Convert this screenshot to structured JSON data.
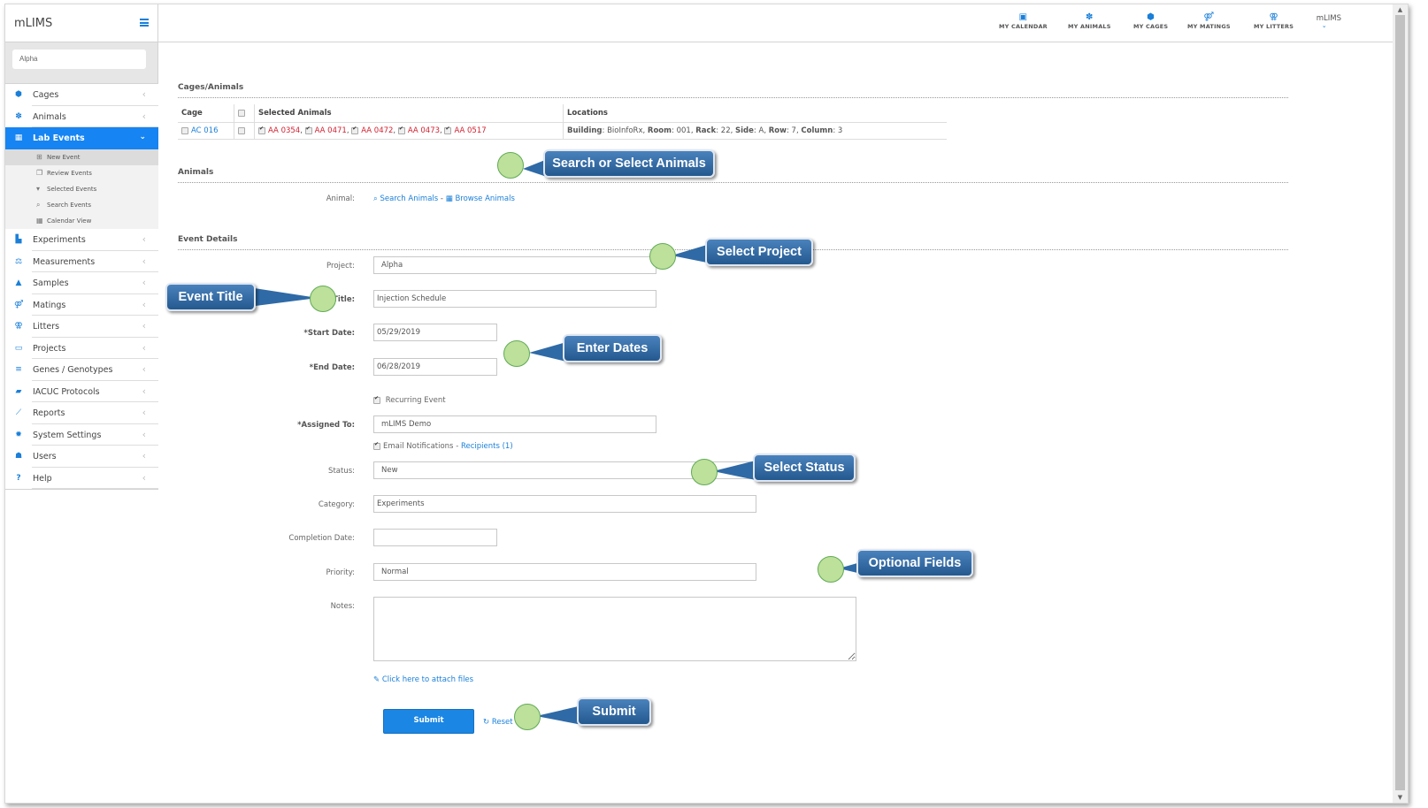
{
  "app": {
    "title": "mLIMS",
    "search_value": "Alpha"
  },
  "sidebar": {
    "items": [
      {
        "label": "Cages",
        "icon": "cube-icon"
      },
      {
        "label": "Animals",
        "icon": "paw-icon"
      },
      {
        "label": "Lab Events",
        "icon": "calendar-icon",
        "active": true
      },
      {
        "label": "Experiments",
        "icon": "flask-doc-icon"
      },
      {
        "label": "Measurements",
        "icon": "balance-scale-icon"
      },
      {
        "label": "Samples",
        "icon": "flask-icon"
      },
      {
        "label": "Matings",
        "icon": "mars-venus-icon"
      },
      {
        "label": "Litters",
        "icon": "venus-double-icon"
      },
      {
        "label": "Projects",
        "icon": "folder-open-icon"
      },
      {
        "label": "Genes / Genotypes",
        "icon": "bars-icon"
      },
      {
        "label": "IACUC Protocols",
        "icon": "book-icon"
      },
      {
        "label": "Reports",
        "icon": "line-chart-icon"
      },
      {
        "label": "System Settings",
        "icon": "gear-icon"
      },
      {
        "label": "Users",
        "icon": "users-icon"
      },
      {
        "label": "Help",
        "icon": "question-icon"
      }
    ],
    "lab_events_sub": [
      {
        "label": "New Event",
        "icon": "calendar-plus-icon",
        "active": true
      },
      {
        "label": "Review Events",
        "icon": "clone-icon"
      },
      {
        "label": "Selected Events",
        "icon": "cart-icon"
      },
      {
        "label": "Search Events",
        "icon": "search-icon"
      },
      {
        "label": "Calendar View",
        "icon": "calendar-grid-icon"
      }
    ]
  },
  "topbar": {
    "items": [
      {
        "label": "MY CALENDAR",
        "icon": "calendar-icon"
      },
      {
        "label": "MY ANIMALS",
        "icon": "paw-icon"
      },
      {
        "label": "MY CAGES",
        "icon": "cube-icon"
      },
      {
        "label": "MY MATINGS",
        "icon": "mars-venus-icon"
      },
      {
        "label": "MY LITTERS",
        "icon": "venus-double-icon"
      }
    ],
    "user": "mLIMS"
  },
  "cages_section": {
    "title": "Cages/Animals",
    "columns": [
      "Cage",
      "",
      "Selected Animals",
      "Locations"
    ],
    "row": {
      "cage": "AC 016",
      "animals": [
        "AA 0354",
        "AA 0471",
        "AA 0472",
        "AA 0473",
        "AA 0517"
      ],
      "location": [
        {
          "key": "Building",
          "value": "BioInfoRx"
        },
        {
          "key": "Room",
          "value": "001"
        },
        {
          "key": "Rack",
          "value": "22"
        },
        {
          "key": "Side",
          "value": "A"
        },
        {
          "key": "Row",
          "value": "7"
        },
        {
          "key": "Column",
          "value": "3"
        }
      ]
    }
  },
  "animals_section": {
    "title": "Animals",
    "animal_label": "Animal:",
    "search_link": "Search Animals",
    "separator": "-",
    "browse_link": "Browse Animals"
  },
  "event_details": {
    "title": "Event Details",
    "project_label": "Project:",
    "project_value": "Alpha",
    "title_label": "*Title:",
    "title_value": "Injection Schedule",
    "start_label": "*Start Date:",
    "start_value": "05/29/2019",
    "end_label": "*End Date:",
    "end_value": "06/28/2019",
    "recurring_label": "Recurring Event",
    "recurring_checked": true,
    "assigned_label": "*Assigned To:",
    "assigned_value": "mLIMS Demo",
    "email_label": "Email Notifications",
    "email_checked": true,
    "email_sep": "-",
    "recipients_link": "Recipients (1)",
    "status_label": "Status:",
    "status_value": "New",
    "category_label": "Category:",
    "category_value": "Experiments",
    "completion_label": "Completion Date:",
    "completion_value": "",
    "priority_label": "Priority:",
    "priority_value": "Normal",
    "notes_label": "Notes:",
    "notes_value": "",
    "attach_link": "Click here to attach files",
    "submit_label": "Submit",
    "reset_label": "Reset"
  },
  "callouts": {
    "search_animals": "Search or Select  Animals",
    "select_project": "Select Project",
    "event_title": "Event Title",
    "enter_dates": "Enter Dates",
    "select_status": "Select Status",
    "optional_fields": "Optional Fields",
    "submit": "Submit"
  }
}
